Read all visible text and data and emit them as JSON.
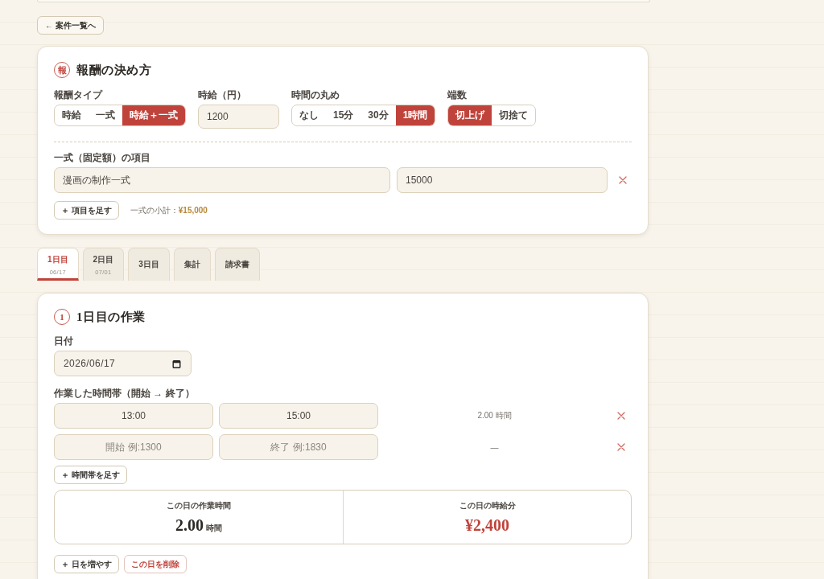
{
  "back_button": "← 案件一覧へ",
  "pay_settings": {
    "marker": "報",
    "title": "報酬の決め方",
    "pay_type": {
      "label": "報酬タイプ",
      "options": [
        {
          "label": "時給",
          "selected": false
        },
        {
          "label": "一式",
          "selected": false
        },
        {
          "label": "時給＋一式",
          "selected": true
        }
      ]
    },
    "hourly_rate": {
      "label": "時給（円）",
      "value": "1200"
    },
    "rounding": {
      "label": "時間の丸め",
      "options": [
        {
          "label": "なし",
          "selected": false
        },
        {
          "label": "15分",
          "selected": false
        },
        {
          "label": "30分",
          "selected": false
        },
        {
          "label": "1時間",
          "selected": true
        }
      ]
    },
    "fraction": {
      "label": "端数",
      "options": [
        {
          "label": "切上げ",
          "selected": true
        },
        {
          "label": "切捨て",
          "selected": false
        }
      ]
    },
    "fixed_items": {
      "label": "一式（固定額）の項目",
      "rows": [
        {
          "name": "漫画の制作一式",
          "amount": "15000"
        }
      ],
      "add_button": "＋ 項目を足す",
      "subtotal": "一式の小計：**¥15,000**"
    }
  },
  "tabs": [
    {
      "label": "1日目",
      "date": "06/17",
      "selected": true
    },
    {
      "label": "2日目",
      "date": "07/01",
      "selected": false
    },
    {
      "label": "3日目",
      "selected": false
    },
    {
      "label": "集計",
      "selected": false
    },
    {
      "label": "請求書",
      "selected": false
    }
  ],
  "day": {
    "marker": "1",
    "title": "1日目の作業",
    "date": {
      "label": "日付",
      "value": "2026/06/17"
    },
    "time_slots": {
      "label": "作業した時間帯（開始 → 終了）",
      "rows": [
        {
          "start": {
            "value": "13:00"
          },
          "end": {
            "value": "15:00"
          },
          "duration": "2.00 時間"
        },
        {
          "start": {
            "placeholder": "開始 例:1300"
          },
          "end": {
            "placeholder": "終了 例:1830"
          },
          "duration": "—"
        }
      ],
      "add_button": "＋ 時間帯を足す"
    },
    "summary": [
      {
        "kind": "hours",
        "label": "この日の作業時間",
        "value": "2.00",
        "unit": "時間"
      },
      {
        "kind": "amount",
        "label": "この日の時給分",
        "value": "¥2,400"
      }
    ],
    "buttons": [
      {
        "kind": "add",
        "label": "＋ 日を増やす"
      },
      {
        "kind": "danger",
        "label": "この日を削除"
      }
    ]
  }
}
